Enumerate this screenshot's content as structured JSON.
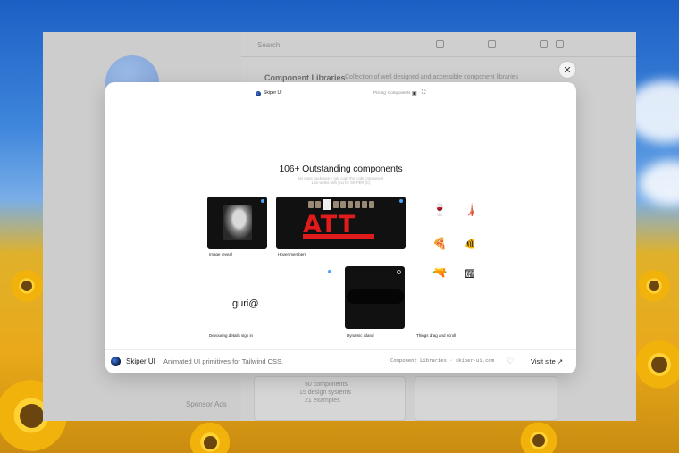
{
  "site": {
    "nav_brand": "Skiper UI",
    "nav_links": [
      "Pricing",
      "Components"
    ],
    "nav_icons": [
      "theme-icon",
      "expand-icon"
    ]
  },
  "hero": {
    "title": "106+ Outstanding components",
    "subtitle_line1": "No more packages + just copy the code component",
    "subtitle_line2": "Live works with you for SKIPER (C)"
  },
  "tiles": [
    {
      "label": "Image reveal"
    },
    {
      "label": "Hover members",
      "word": "ATT"
    },
    {
      "label": "Things drag and scroll"
    },
    {
      "label": "Devouring details sign in",
      "text": "guri@"
    },
    {
      "label": "Dynamic island"
    }
  ],
  "footer": {
    "name": "Skiper UI",
    "description": "Animated UI primitives for Tailwind CSS.",
    "meta": "Component Libraries · skiper-ui.com",
    "visit_label": "Visit site",
    "visit_icon": "↗",
    "heart_icon": "♡"
  },
  "close_icon": "✕",
  "background": {
    "search_label": "Search",
    "section_title": "Component Libraries",
    "section_desc": "Collection of well designed and accessible component libraries",
    "card_texts": [
      "50 components",
      "15 design systems",
      "21 examples"
    ],
    "side_texts": [
      "Sponsor",
      "Ads"
    ]
  },
  "colors": {
    "accent_dot": "#4aa3ff",
    "red_word": "#e01b1b"
  }
}
